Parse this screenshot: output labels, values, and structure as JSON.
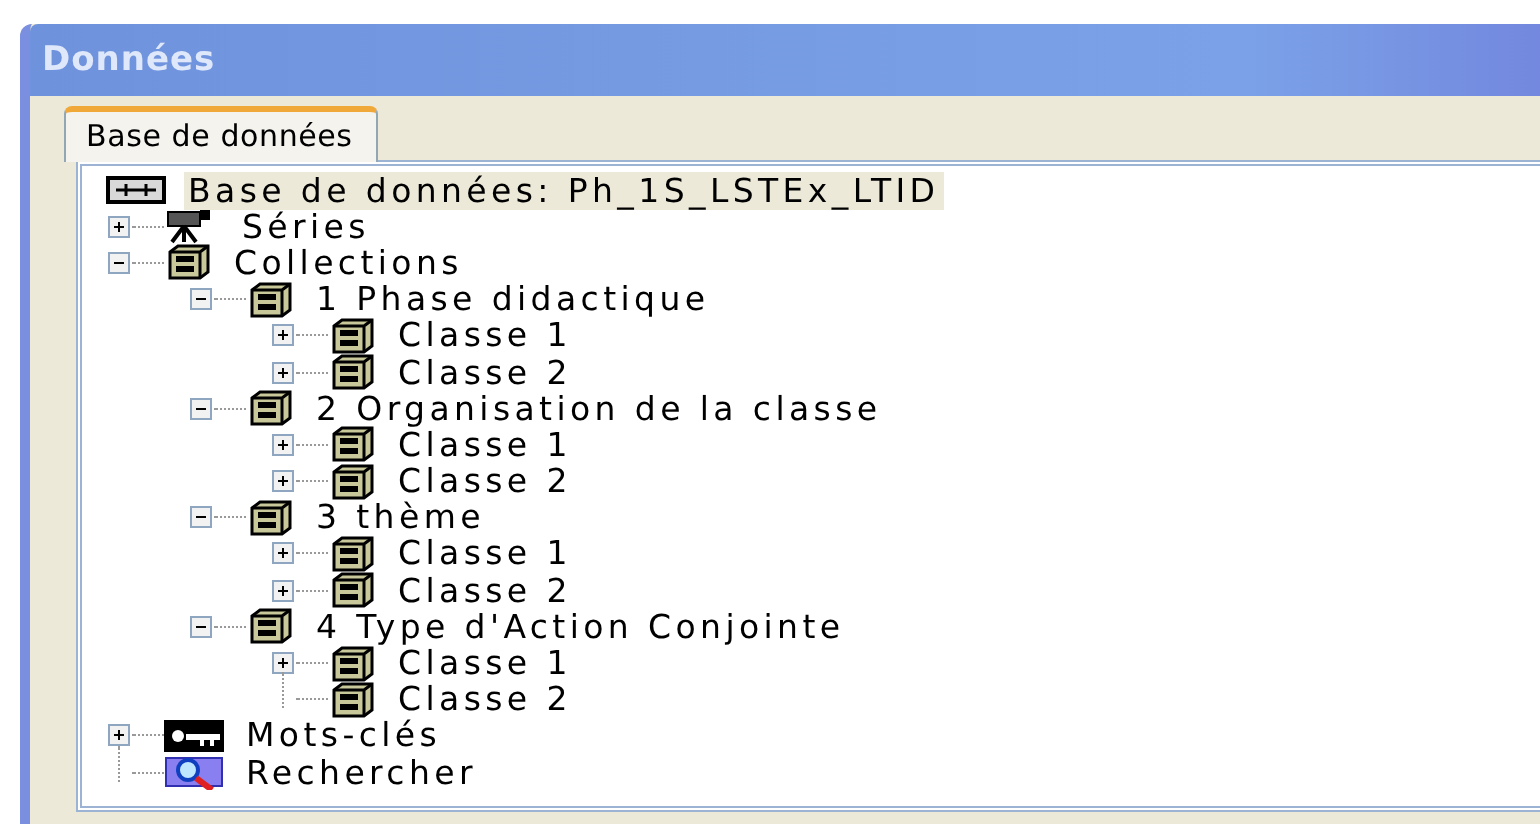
{
  "window": {
    "title": "Données"
  },
  "tabs": [
    {
      "label": "Base de données",
      "selected": true
    }
  ],
  "tree": [
    {
      "label": "Base de données: Ph_1S_LSTEx_LTID",
      "kind": "database",
      "selected": true,
      "children": [
        {
          "label": "Séries",
          "kind": "camera",
          "selected": false,
          "expanded": false
        },
        {
          "label": "Collections",
          "kind": "cabinet",
          "selected": false,
          "expanded": true,
          "children": [
            {
              "label": "1 Phase didactique",
              "kind": "cabinet",
              "selected": false,
              "expanded": true,
              "children": [
                {
                  "label": "Classe 1",
                  "kind": "cabinet",
                  "selected": false,
                  "expanded": false
                },
                {
                  "label": "Classe 2",
                  "kind": "cabinet",
                  "selected": false,
                  "expanded": false
                }
              ]
            },
            {
              "label": "2 Organisation de la classe",
              "kind": "cabinet",
              "selected": false,
              "expanded": true,
              "children": [
                {
                  "label": "Classe 1",
                  "kind": "cabinet",
                  "selected": false,
                  "expanded": false
                },
                {
                  "label": "Classe 2",
                  "kind": "cabinet",
                  "selected": false,
                  "expanded": false
                }
              ]
            },
            {
              "label": "3 thème",
              "kind": "cabinet",
              "selected": false,
              "expanded": true,
              "children": [
                {
                  "label": "Classe 1",
                  "kind": "cabinet",
                  "selected": false,
                  "expanded": false
                },
                {
                  "label": "Classe 2",
                  "kind": "cabinet",
                  "selected": false,
                  "expanded": false
                }
              ]
            },
            {
              "label": "4 Type d'Action Conjointe",
              "kind": "cabinet",
              "selected": false,
              "expanded": true,
              "children": [
                {
                  "label": "Classe 1",
                  "kind": "cabinet",
                  "selected": false,
                  "expanded": false
                },
                {
                  "label": "Classe 2",
                  "kind": "cabinet",
                  "selected": false
                }
              ]
            }
          ]
        },
        {
          "label": "Mots-clés",
          "kind": "key",
          "selected": false,
          "expanded": false
        },
        {
          "label": "Rechercher",
          "kind": "search",
          "selected": false
        }
      ]
    }
  ]
}
